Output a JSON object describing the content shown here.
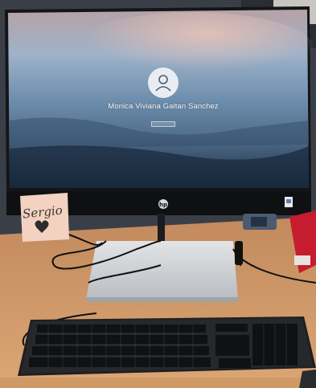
{
  "lock_screen": {
    "user_name": "Monica Viviana Gaitan Sanchez",
    "avatar_icon": "user-avatar-icon",
    "subtext": "",
    "signin_icon": "signin-button"
  },
  "sticky_note": {
    "text": "Sergio",
    "heart_icon": "heart-doodle-icon"
  },
  "monitor": {
    "logo_icon": "hp-logo-icon",
    "badge_icon": "sticker-badge-icon"
  },
  "colors": {
    "desk": "#d39a6a",
    "screen_sky": "#8db2d6",
    "monitor_bezel": "#141518",
    "sticky_note": "#f3d2c2"
  }
}
